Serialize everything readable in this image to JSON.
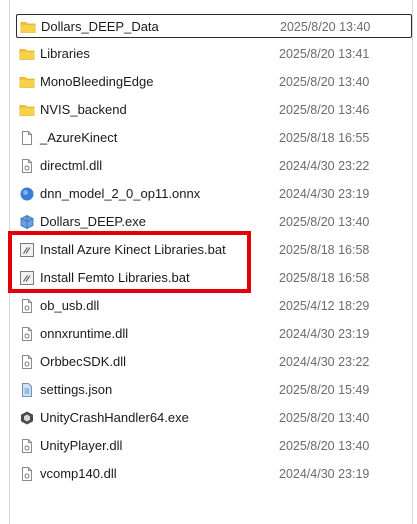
{
  "file_list": {
    "rows": [
      {
        "name": "Dollars_DEEP_Data",
        "modified": "2025/8/20 13:40",
        "icon": "folder-icon"
      },
      {
        "name": "Libraries",
        "modified": "2025/8/20 13:41",
        "icon": "folder-icon"
      },
      {
        "name": "MonoBleedingEdge",
        "modified": "2025/8/20 13:40",
        "icon": "folder-icon"
      },
      {
        "name": "NVIS_backend",
        "modified": "2025/8/20 13:46",
        "icon": "folder-icon"
      },
      {
        "name": "_AzureKinect",
        "modified": "2025/8/18 16:55",
        "icon": "blank-file-icon"
      },
      {
        "name": "directml.dll",
        "modified": "2024/4/30 23:22",
        "icon": "dll-file-icon"
      },
      {
        "name": "dnn_model_2_0_op11.onnx",
        "modified": "2024/4/30 23:19",
        "icon": "onnx-file-icon"
      },
      {
        "name": "Dollars_DEEP.exe",
        "modified": "2025/8/20 13:40",
        "icon": "exe-app-icon"
      },
      {
        "name": "Install Azure Kinect Libraries.bat",
        "modified": "2025/8/18 16:58",
        "icon": "batch-file-icon"
      },
      {
        "name": "Install Femto Libraries.bat",
        "modified": "2025/8/18 16:58",
        "icon": "batch-file-icon"
      },
      {
        "name": "ob_usb.dll",
        "modified": "2025/4/12 18:29",
        "icon": "dll-file-icon"
      },
      {
        "name": "onnxruntime.dll",
        "modified": "2024/4/30 23:19",
        "icon": "dll-file-icon"
      },
      {
        "name": "OrbbecSDK.dll",
        "modified": "2024/4/30 23:22",
        "icon": "dll-file-icon"
      },
      {
        "name": "settings.json",
        "modified": "2025/8/20 15:49",
        "icon": "json-file-icon"
      },
      {
        "name": "UnityCrashHandler64.exe",
        "modified": "2025/8/20 13:40",
        "icon": "unity-exe-icon"
      },
      {
        "name": "UnityPlayer.dll",
        "modified": "2025/8/20 13:40",
        "icon": "dll-file-icon"
      },
      {
        "name": "vcomp140.dll",
        "modified": "2024/4/30 23:19",
        "icon": "dll-file-icon"
      }
    ]
  },
  "colors": {
    "folder": "#f4c430",
    "highlight_border": "#e3000b",
    "date_text": "#6b6b6b"
  }
}
